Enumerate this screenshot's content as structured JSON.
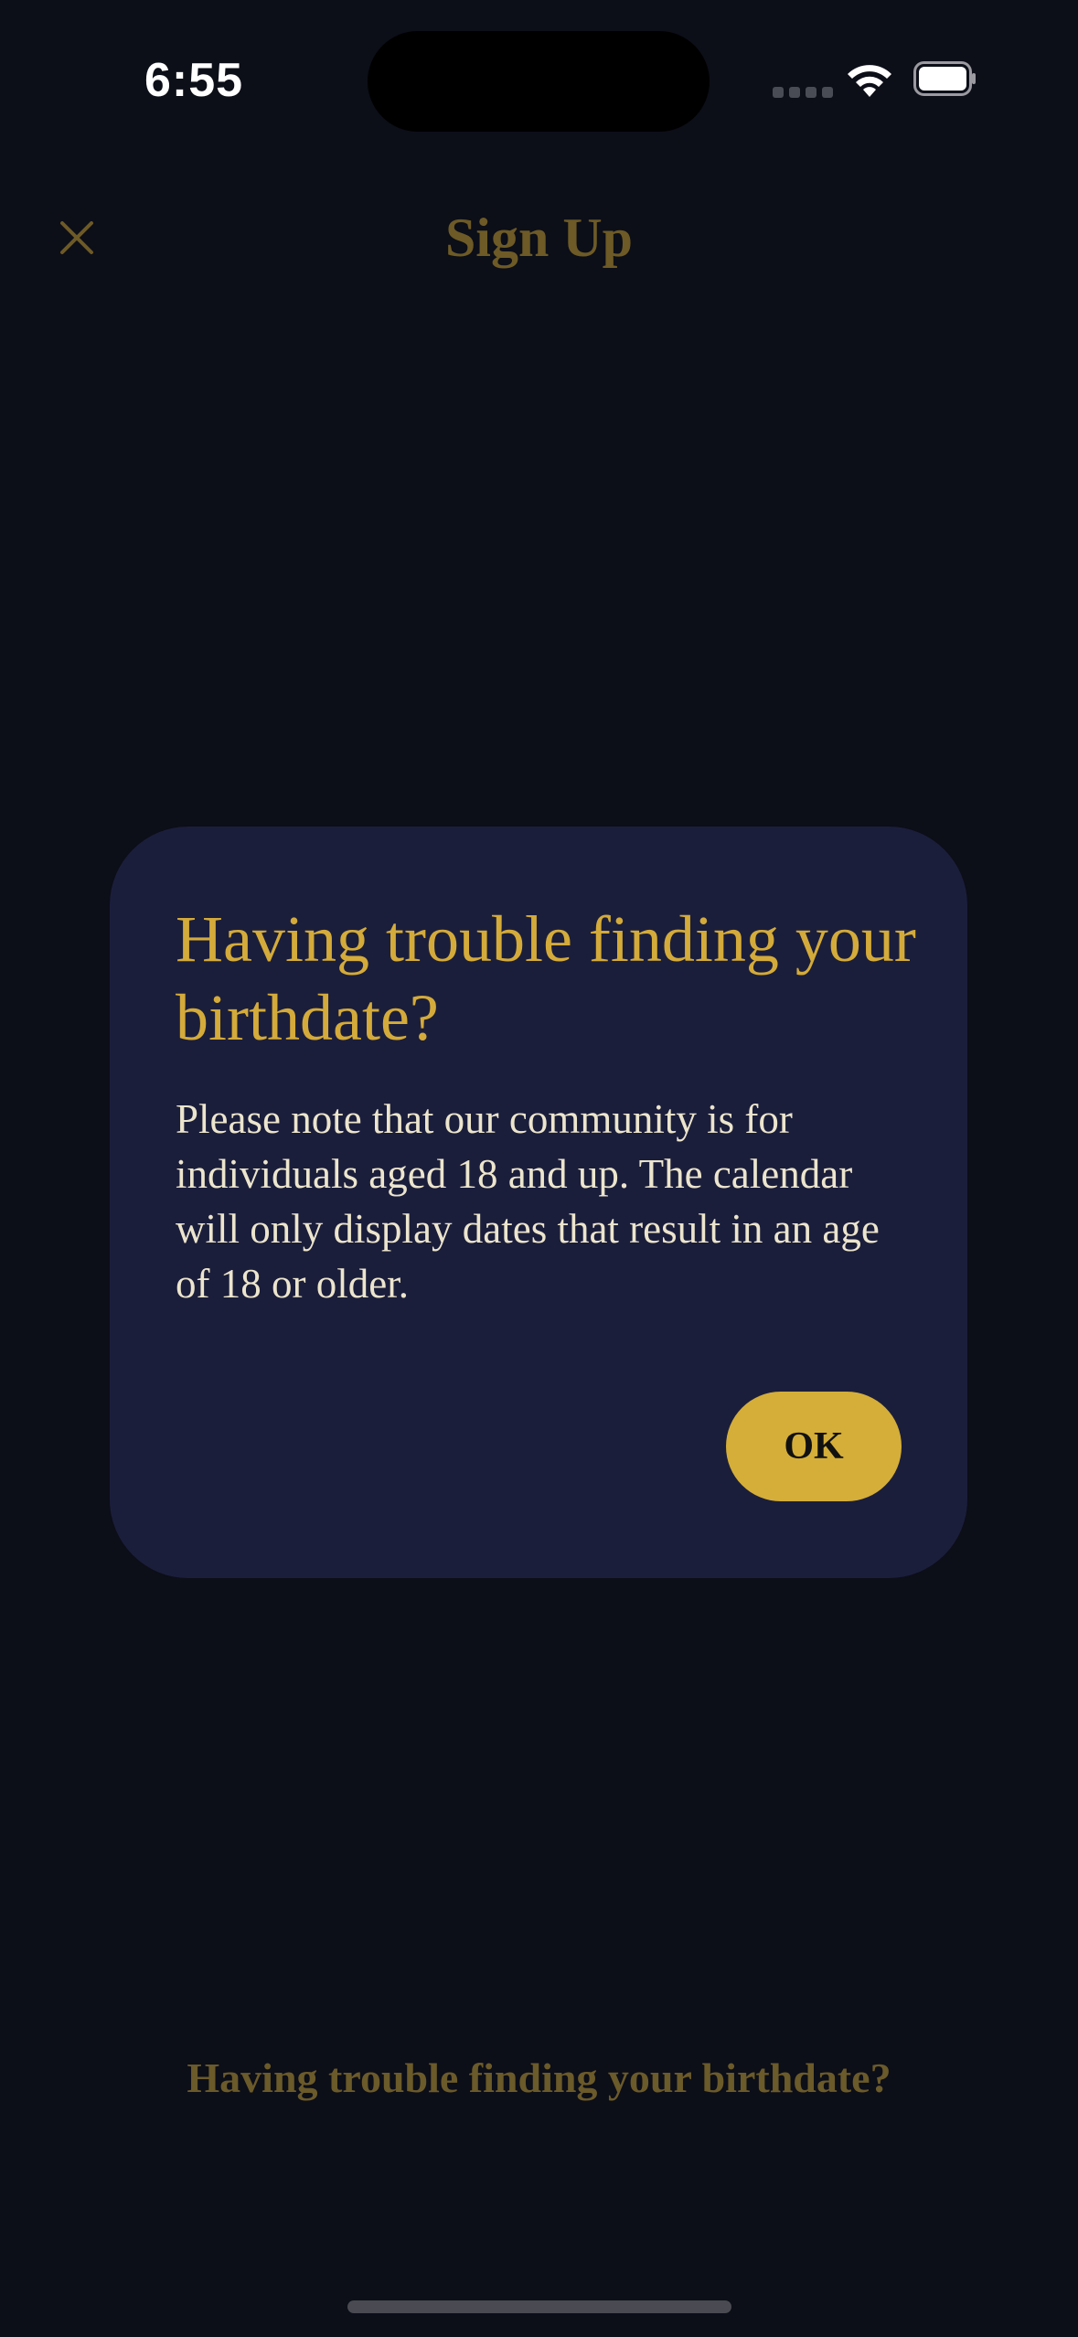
{
  "status_bar": {
    "time": "6:55",
    "icons": [
      "cellular-signal-icon",
      "wifi-icon",
      "battery-icon"
    ]
  },
  "header": {
    "close_icon": "close-icon",
    "title": "Sign Up"
  },
  "footer": {
    "link_text": "Having trouble finding your birthdate?"
  },
  "modal": {
    "title": "Having trouble finding your birthdate?",
    "body": "Please note that our community is for individuals aged 18 and up. The calendar will only display dates that result in an age of 18 or older.",
    "ok_label": "OK"
  },
  "colors": {
    "background": "#0c0e18",
    "modal_background": "#1b1e3b",
    "accent_gold": "#d4ab3a",
    "dimmed_gold": "#6d5a26",
    "body_text": "#ece5cd"
  }
}
